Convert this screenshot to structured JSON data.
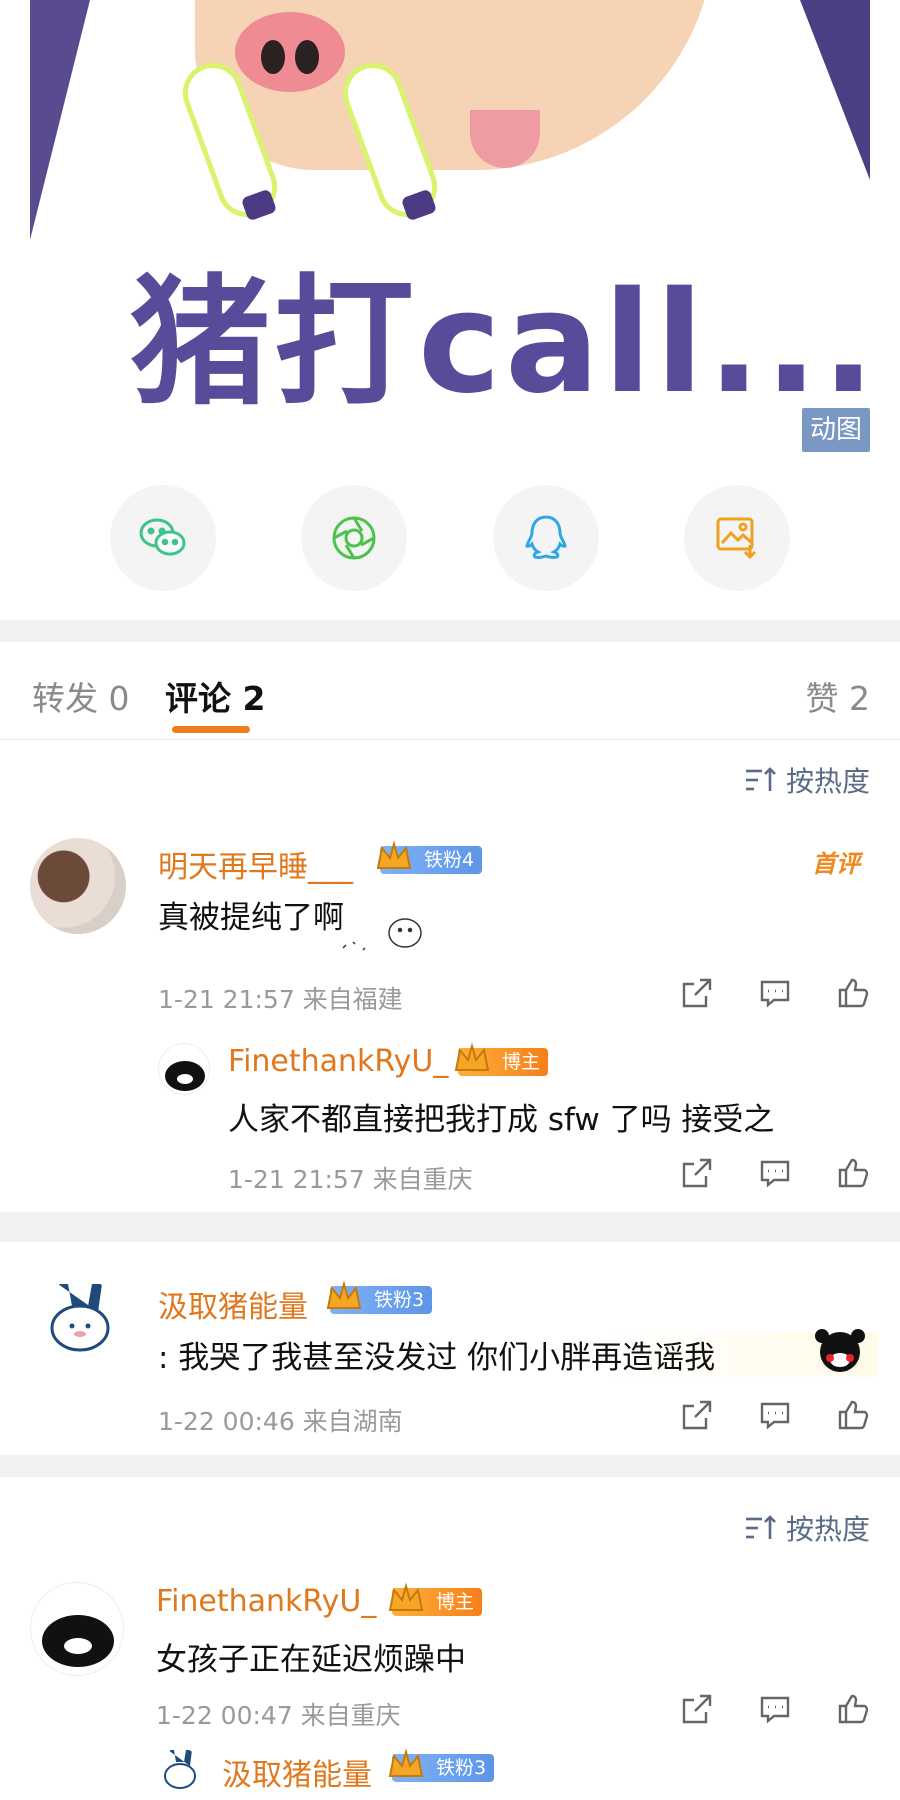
{
  "hero": {
    "caption": "猪打call...",
    "gif_badge": "动图"
  },
  "share": {
    "items": [
      "wechat-icon",
      "moments-icon",
      "qq-icon",
      "save-image-icon"
    ]
  },
  "tabs": {
    "repost": "转发 0",
    "comments": "评论 2",
    "likes": "赞 2"
  },
  "sort_label": "按热度",
  "comments": [
    {
      "user": "明天再早睡___",
      "badge": "铁粉4",
      "label": "首评",
      "text": "真被提纯了啊",
      "time": "1-21 21:57 来自福建",
      "reply": {
        "user": "FinethankRyU_",
        "badge": "博主",
        "text": "人家不都直接把我打成 sfw 了吗 接受之",
        "time": "1-21 21:57 来自重庆"
      }
    },
    {
      "user": "汲取猪能量",
      "badge": "铁粉3",
      "text": ": 我哭了我甚至没发过 你们小胖再造谣我",
      "time": "1-22 00:46 来自湖南"
    }
  ],
  "second_block": {
    "sort_label": "按热度",
    "comment": {
      "user": "FinethankRyU_",
      "badge": "博主",
      "text": "女孩子正在延迟烦躁中",
      "time": "1-22 00:47 来自重庆"
    },
    "reply_user": "汲取猪能量",
    "reply_badge": "铁粉3"
  },
  "colors": {
    "accent": "#f07f1a",
    "username": "#e0781e",
    "sort": "#5b6b86"
  }
}
